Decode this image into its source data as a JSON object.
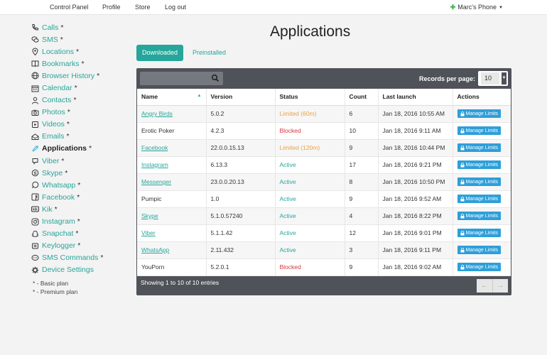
{
  "topnav": [
    "Control Panel",
    "Profile",
    "Store",
    "Log out"
  ],
  "device": {
    "name": "Marc's Phone"
  },
  "sidebar": {
    "items": [
      {
        "label": "Calls",
        "mark": "*",
        "icon": "phone-icon"
      },
      {
        "label": "SMS",
        "mark": "*",
        "icon": "chat-icon"
      },
      {
        "label": "Locations",
        "mark": "*",
        "icon": "map-pin-icon"
      },
      {
        "label": "Bookmarks",
        "mark": "*",
        "icon": "book-icon"
      },
      {
        "label": "Browser History",
        "mark": "*",
        "icon": "globe-icon"
      },
      {
        "label": "Calendar",
        "mark": "*",
        "icon": "calendar-icon"
      },
      {
        "label": "Contacts",
        "mark": "*",
        "icon": "user-icon"
      },
      {
        "label": "Photos",
        "mark": "*",
        "icon": "camera-icon"
      },
      {
        "label": "Videos",
        "mark": "*",
        "icon": "video-icon"
      },
      {
        "label": "Emails",
        "mark": "*",
        "icon": "envelope-icon"
      },
      {
        "label": "Applications",
        "mark": "*",
        "icon": "android-icon",
        "active": true
      },
      {
        "label": "Viber",
        "mark": "*",
        "icon": "viber-icon"
      },
      {
        "label": "Skype",
        "mark": "*",
        "icon": "skype-icon"
      },
      {
        "label": "Whatsapp",
        "mark": "*",
        "icon": "whatsapp-icon"
      },
      {
        "label": "Facebook",
        "mark": "*",
        "icon": "facebook-icon"
      },
      {
        "label": "Kik",
        "mark": "*",
        "icon": "kik-icon"
      },
      {
        "label": "Instagram",
        "mark": "*",
        "icon": "instagram-icon"
      },
      {
        "label": "Snapchat",
        "mark": "*",
        "icon": "snapchat-icon"
      },
      {
        "label": "Keylogger",
        "mark": "*",
        "icon": "keyboard-icon"
      },
      {
        "label": "SMS Commands",
        "mark": "*",
        "icon": "sms-command-icon"
      },
      {
        "label": "Device Settings",
        "mark": "",
        "icon": "gear-icon"
      }
    ],
    "legend": [
      "* - Basic plan",
      "* - Premium plan"
    ]
  },
  "page": {
    "title": "Applications"
  },
  "tabs": [
    "Downloaded",
    "Preinstalled"
  ],
  "table": {
    "records_label": "Records per page:",
    "records_value": "10",
    "columns": [
      "Name",
      "Version",
      "Status",
      "Count",
      "Last launch",
      "Actions"
    ],
    "action_label": "Manage Limits",
    "rows": [
      {
        "name": "Angry Birds",
        "link": true,
        "version": "5.0.2",
        "status": "Limited (60m)",
        "status_type": "limited",
        "count": "6",
        "last": "Jan 18, 2016 10:55 AM"
      },
      {
        "name": "Erotic Poker",
        "link": false,
        "version": "4.2.3",
        "status": "Blocked",
        "status_type": "blocked",
        "count": "10",
        "last": "Jan 18, 2016 9:11 AM"
      },
      {
        "name": "Facebook",
        "link": true,
        "version": "22.0.0.15.13",
        "status": "Limited (120m)",
        "status_type": "limited",
        "count": "9",
        "last": "Jan 18, 2016 10:44 PM"
      },
      {
        "name": "Instagram",
        "link": true,
        "version": "6.13.3",
        "status": "Active",
        "status_type": "active",
        "count": "17",
        "last": "Jan 18, 2016 9:21 PM"
      },
      {
        "name": "Messenger",
        "link": true,
        "version": "23.0.0.20.13",
        "status": "Active",
        "status_type": "active",
        "count": "8",
        "last": "Jan 18, 2016 10:50 PM"
      },
      {
        "name": "Pumpic",
        "link": false,
        "version": "1.0",
        "status": "Active",
        "status_type": "active",
        "count": "9",
        "last": "Jan 18, 2016 9:52 AM"
      },
      {
        "name": "Skype",
        "link": true,
        "version": "5.1.0.57240",
        "status": "Active",
        "status_type": "active",
        "count": "4",
        "last": "Jan 18, 2016 8:22 PM"
      },
      {
        "name": "Viber",
        "link": true,
        "version": "5.1.1.42",
        "status": "Active",
        "status_type": "active",
        "count": "12",
        "last": "Jan 18, 2016 9:01 PM"
      },
      {
        "name": "WhatsApp",
        "link": true,
        "version": "2.11.432",
        "status": "Active",
        "status_type": "active",
        "count": "3",
        "last": "Jan 18, 2016 9:11 PM"
      },
      {
        "name": "YouPorn",
        "link": false,
        "version": "5.2.0.1",
        "status": "Blocked",
        "status_type": "blocked",
        "count": "9",
        "last": "Jan 18, 2016 9:02 AM"
      }
    ],
    "footer": "Showing 1 to 10 of 10 entries",
    "pager": [
      "←",
      "→"
    ]
  },
  "colors": {
    "accent": "#26a69a",
    "panel": "#505259",
    "blocked": "#d9363e",
    "limited": "#f0a040",
    "button": "#2d9fd9"
  }
}
